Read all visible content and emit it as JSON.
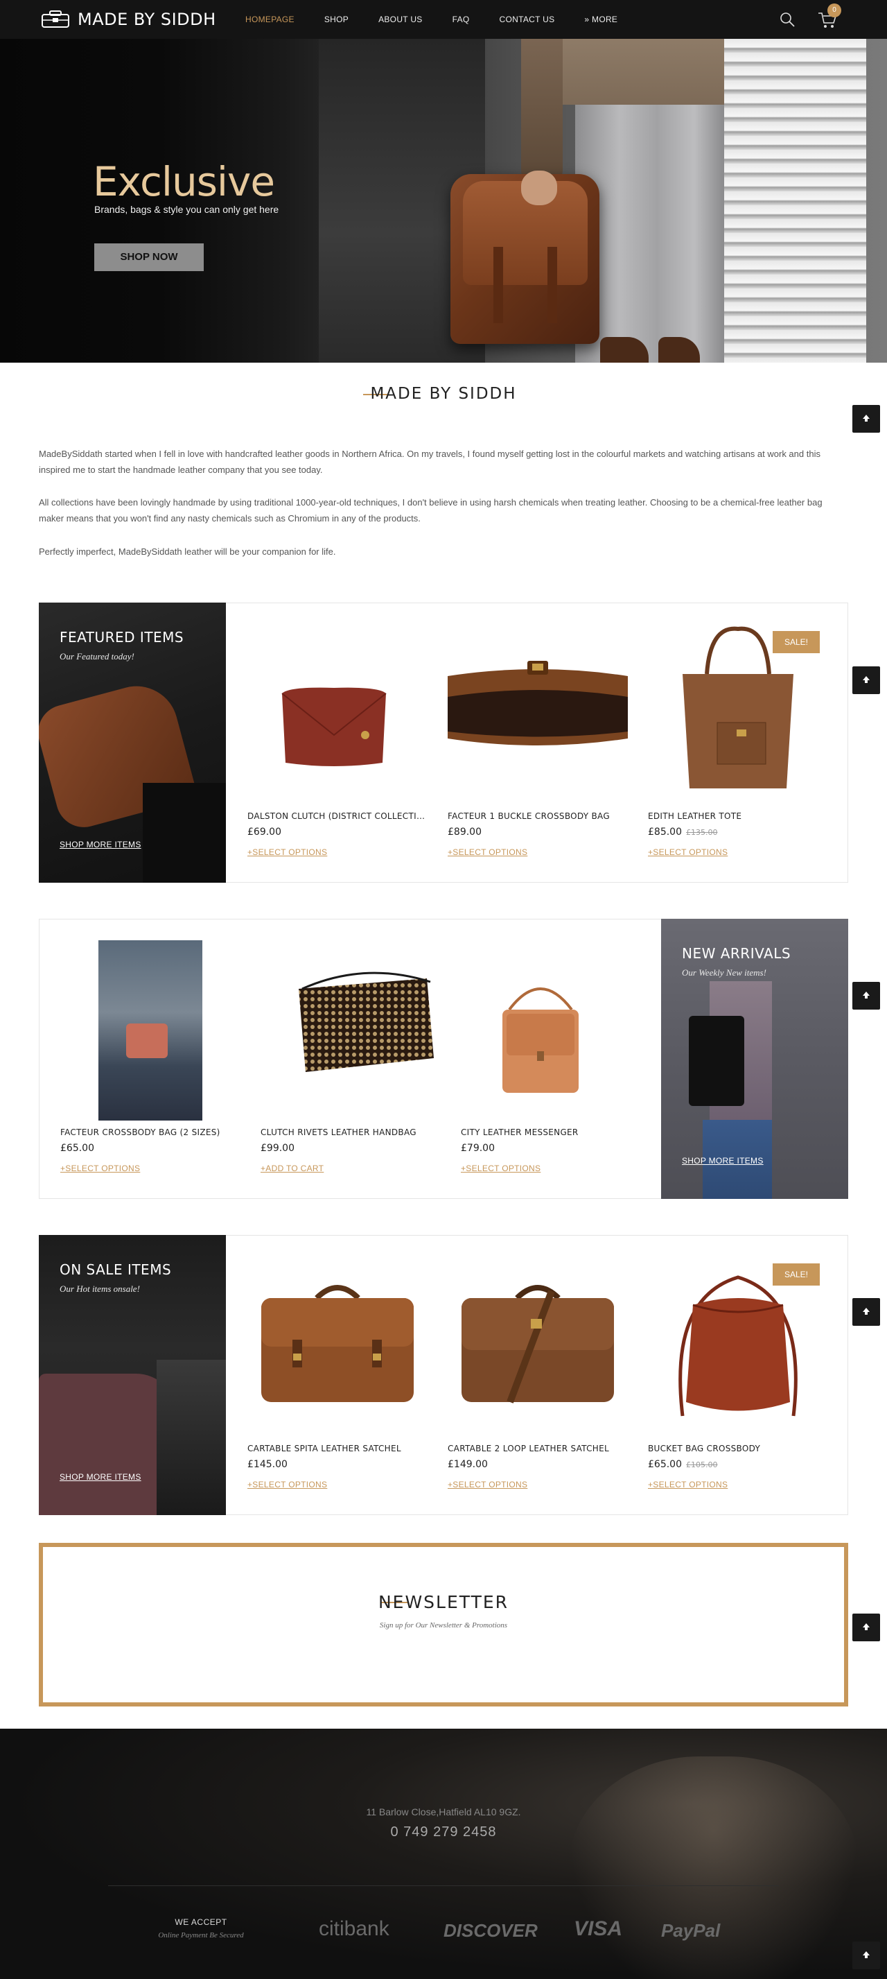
{
  "brand": {
    "name": "MADE BY SIDDH",
    "accent": "#c7975a"
  },
  "nav": {
    "items": [
      {
        "label": "HOMEPAGE",
        "active": true
      },
      {
        "label": "SHOP"
      },
      {
        "label": "ABOUT US"
      },
      {
        "label": "FAQ"
      },
      {
        "label": "CONTACT US"
      },
      {
        "label": "» MORE"
      }
    ],
    "cart_count": "0"
  },
  "hero": {
    "title": "Exclusive",
    "subtitle": "Brands, bags & style you can only get here",
    "button": "SHOP NOW"
  },
  "about": {
    "title": "MADE BY SIDDH",
    "paragraphs": [
      "MadeBySiddath started when I fell in love with handcrafted leather goods in Northern Africa. On my travels, I found myself getting lost in the colourful markets and watching artisans at work and this inspired me to start the handmade leather company that you see today.",
      "All collections have been lovingly handmade by using traditional 1000-year-old techniques, I don't believe in using harsh chemicals when treating leather. Choosing to be a chemical-free leather bag maker means that you won't find any nasty chemicals such as Chromium in any of the products.",
      "Perfectly imperfect, MadeBySiddath leather will be your companion for life."
    ]
  },
  "featured": {
    "title": "FEATURED ITEMS",
    "subtitle": "Our Featured today!",
    "link": "SHOP MORE ITEMS",
    "products": [
      {
        "name": "DALSTON CLUTCH (DISTRICT COLLECTION) LEATHER CLUTCH",
        "price": "£69.00",
        "old_price": "",
        "action": "+SELECT OPTIONS"
      },
      {
        "name": "FACTEUR 1 BUCKLE CROSSBODY BAG",
        "price": "£89.00",
        "old_price": "",
        "action": "+SELECT OPTIONS"
      },
      {
        "name": "EDITH LEATHER TOTE",
        "price": "£85.00",
        "old_price": "£135.00",
        "action": "+SELECT OPTIONS",
        "sale": "SALE!"
      }
    ]
  },
  "arrivals": {
    "title": "NEW ARRIVALS",
    "subtitle": "Our Weekly New items!",
    "link": "SHOP MORE ITEMS",
    "products": [
      {
        "name": "FACTEUR CROSSBODY BAG (2 SIZES)",
        "price": "£65.00",
        "old_price": "",
        "action": "+SELECT OPTIONS"
      },
      {
        "name": "CLUTCH RIVETS LEATHER HANDBAG",
        "price": "£99.00",
        "old_price": "",
        "action": "+ADD TO CART"
      },
      {
        "name": "CITY LEATHER MESSENGER",
        "price": "£79.00",
        "old_price": "",
        "action": "+SELECT OPTIONS"
      }
    ]
  },
  "onsale": {
    "title": "ON SALE ITEMS",
    "subtitle": "Our Hot items onsale!",
    "link": "SHOP MORE ITEMS",
    "products": [
      {
        "name": "CARTABLE SPITA LEATHER SATCHEL",
        "price": "£145.00",
        "old_price": "",
        "action": "+SELECT OPTIONS"
      },
      {
        "name": "CARTABLE 2 LOOP LEATHER SATCHEL",
        "price": "£149.00",
        "old_price": "",
        "action": "+SELECT OPTIONS"
      },
      {
        "name": "BUCKET BAG CROSSBODY",
        "price": "£65.00",
        "old_price": "£105.00",
        "action": "+SELECT OPTIONS",
        "sale": "SALE!"
      }
    ]
  },
  "newsletter": {
    "title": "NEWSLETTER",
    "subtitle": "Sign up for Our Newsletter & Promotions"
  },
  "footer": {
    "address": "11 Barlow Close,Hatfield AL10 9GZ.",
    "phone": "0 749 279 2458",
    "we_accept": "WE ACCEPT",
    "online_payment": "Online Payment Be Secured",
    "payment_logos": [
      "citibank",
      "DISCOVER",
      "VISA",
      "PayPal"
    ]
  },
  "icons": [
    "logo-bag-icon",
    "search-icon",
    "cart-icon",
    "arrow-up-icon"
  ]
}
